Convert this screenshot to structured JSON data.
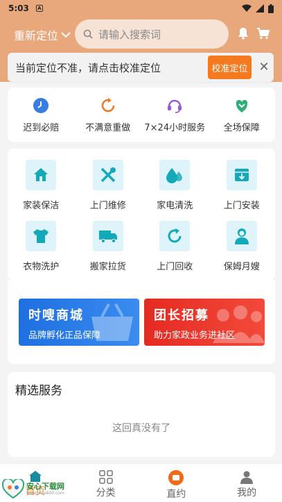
{
  "status_bar": {
    "time": "5:03",
    "notif_letter": "A"
  },
  "header": {
    "location_label": "重新定位",
    "search_placeholder": "请输入搜索词"
  },
  "notice": {
    "text": "当前定位不准，请点击校准定位",
    "button": "校准定位",
    "close": "✕"
  },
  "guarantees": [
    {
      "label": "迟到必赔",
      "icon": "clock-icon",
      "color": "#3a7de0"
    },
    {
      "label": "不满意重做",
      "icon": "redo-icon",
      "color": "#f07a2a"
    },
    {
      "label": "7×24小时服务",
      "icon": "headset-icon",
      "color": "#9a5ad8"
    },
    {
      "label": "全场保障",
      "icon": "shield-heart-icon",
      "color": "#2fae7a"
    }
  ],
  "services": [
    {
      "label": "家装保洁",
      "icon": "house-icon"
    },
    {
      "label": "上门维修",
      "icon": "tools-icon"
    },
    {
      "label": "家电清洗",
      "icon": "water-drops-icon"
    },
    {
      "label": "上门安装",
      "icon": "box-down-icon"
    },
    {
      "label": "衣物洗护",
      "icon": "shirt-icon"
    },
    {
      "label": "搬家拉货",
      "icon": "truck-icon"
    },
    {
      "label": "上门回收",
      "icon": "recycle-icon"
    },
    {
      "label": "保姆月嫂",
      "icon": "nanny-icon"
    }
  ],
  "service_icon_color": "#14a9b8",
  "banners": [
    {
      "title": "时嗖商城",
      "subtitle": "品牌孵化正品保障"
    },
    {
      "title": "团长招募",
      "subtitle": "助力家政业务进社区"
    }
  ],
  "selected": {
    "title": "精选服务",
    "empty": "这回真没有了"
  },
  "tabs": [
    {
      "label": "首页",
      "icon": "home-icon",
      "active": true
    },
    {
      "label": "分类",
      "icon": "grid-icon",
      "active": false
    },
    {
      "label": "直约",
      "icon": "appointment-icon",
      "active": false
    },
    {
      "label": "我的",
      "icon": "user-icon",
      "active": false
    }
  ],
  "watermark": {
    "text": "安心下载网",
    "url": "www.jinia800.com"
  },
  "accent_color": "#f57a1f",
  "header_color": "#e9a77c"
}
